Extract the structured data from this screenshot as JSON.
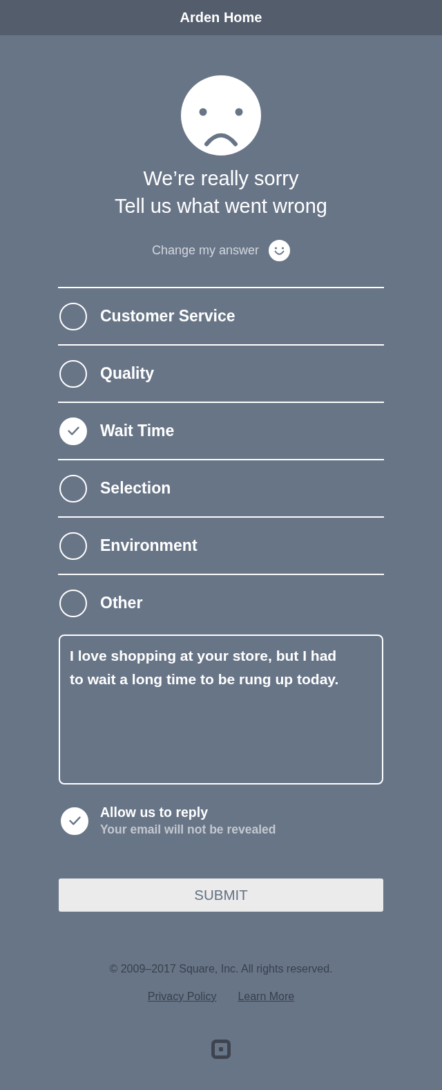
{
  "header": {
    "title": "Arden Home"
  },
  "hero": {
    "headline": "We’re really sorry",
    "subheadline": "Tell us what went wrong"
  },
  "change_answer": {
    "label": "Change my answer"
  },
  "reasons": [
    {
      "label": "Customer Service",
      "selected": false
    },
    {
      "label": "Quality",
      "selected": false
    },
    {
      "label": "Wait Time",
      "selected": true
    },
    {
      "label": "Selection",
      "selected": false
    },
    {
      "label": "Environment",
      "selected": false
    },
    {
      "label": "Other",
      "selected": false
    }
  ],
  "comment": {
    "value": "I love shopping at your store, but I had to wait a long time to be rung up today."
  },
  "reply_option": {
    "label": "Allow us to reply",
    "hint": "Your email will not be revealed",
    "checked": true
  },
  "submit": {
    "label": "SUBMIT"
  },
  "footer": {
    "copyright": "© 2009–2017 Square, Inc. All rights reserved.",
    "links": [
      "Privacy Policy",
      "Learn More"
    ]
  }
}
